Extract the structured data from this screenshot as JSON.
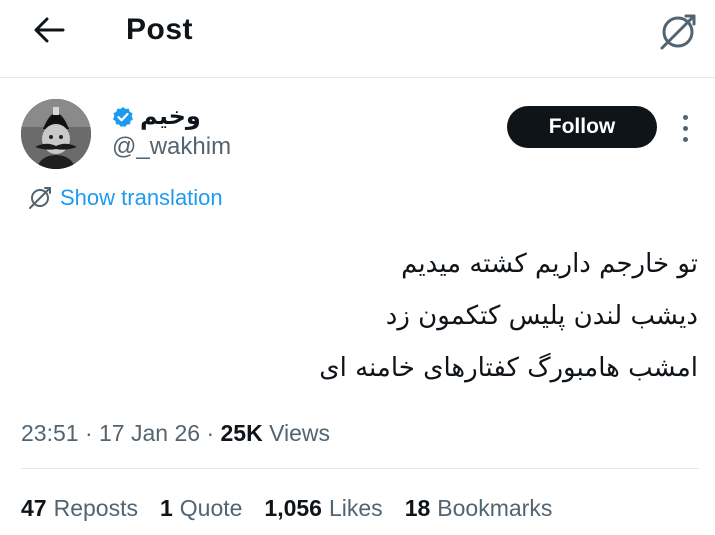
{
  "header": {
    "title": "Post",
    "back_icon": "arrow-left-icon",
    "translate_icon": "translate-icon"
  },
  "author": {
    "display_name": "وخیم",
    "handle": "@_wakhim",
    "verified": true,
    "verified_color": "#1d9bf0"
  },
  "follow_label": "Follow",
  "show_translation_label": "Show translation",
  "post_lines": [
    "تو خارجم داریم کشته میدیم",
    "دیشب لندن پلیس کتکمون زد",
    "امشب هامبورگ کفتارهای خامنه ای"
  ],
  "meta": {
    "time": "23:51",
    "separator": "·",
    "date": "17 Jan 26",
    "views_count": "25K",
    "views_label": "Views"
  },
  "stats": [
    {
      "count": "47",
      "label": "Reposts"
    },
    {
      "count": "1",
      "label": "Quote"
    },
    {
      "count": "1,056",
      "label": "Likes"
    },
    {
      "count": "18",
      "label": "Bookmarks"
    }
  ],
  "colors": {
    "accent": "#1d9bf0",
    "text": "#0f1419",
    "secondary": "#536471",
    "border": "#e1e8ed"
  }
}
